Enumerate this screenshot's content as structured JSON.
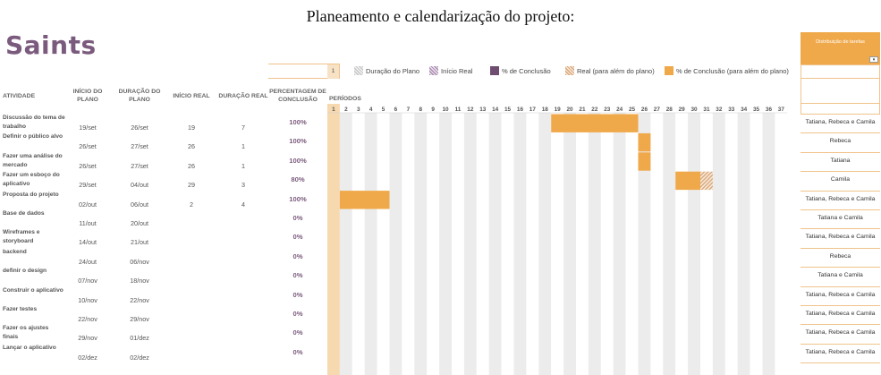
{
  "document_title": "Planeamento e calendarização do projeto:",
  "app_title": "Saints",
  "period_highlight": "1",
  "legend": [
    {
      "label": "Duração do Plano",
      "swatch": "plan-hatch"
    },
    {
      "label": "Início Real",
      "swatch": "start-hatch"
    },
    {
      "label": "% de Conclusão",
      "swatch": "purple-solid",
      "color": "#6f4d70"
    },
    {
      "label": "Real (para além do plano)",
      "swatch": "orange-hatch"
    },
    {
      "label": "% de Conclusão (para além do plano)",
      "swatch": "orange-solid",
      "color": "#f0a94a"
    }
  ],
  "headers": {
    "activity": "ATIVIDADE",
    "plan_start": "INÍCIO DO PLANO",
    "plan_duration": "DURAÇÃO DO PLANO",
    "actual_start": "INÍCIO REAL",
    "actual_duration": "DURAÇÃO REAL",
    "percent": "PERCENTAGEM DE CONCLUSÃO",
    "periods": "PERÍODOS"
  },
  "periods": [
    "1",
    "2",
    "3",
    "4",
    "5",
    "6",
    "7",
    "8",
    "9",
    "10",
    "11",
    "12",
    "13",
    "14",
    "15",
    "16",
    "17",
    "18",
    "19",
    "20",
    "21",
    "22",
    "23",
    "24",
    "25",
    "26",
    "27",
    "28",
    "29",
    "30",
    "31",
    "32",
    "33",
    "34",
    "35",
    "36",
    "37"
  ],
  "side_title": "Distribuição de tarefas",
  "side_button": "▾",
  "colors": {
    "accent": "#f0a94a",
    "brand": "#7b5b7d",
    "grid_stripe": "#ececec"
  },
  "rows": [
    {
      "activity": "Discussão do tema de trabalho",
      "plan_start": "19/set",
      "plan_duration": "26/set",
      "actual_start": "19",
      "actual_duration": "7",
      "percent": "100%",
      "assignee": "Tatiana, Rebeca e Camila",
      "bar_start": 19,
      "bar_length": 7,
      "hatch_start": 0,
      "hatch_length": 0
    },
    {
      "activity": "Definir o público alvo",
      "plan_start": "26/set",
      "plan_duration": "27/set",
      "actual_start": "26",
      "actual_duration": "1",
      "percent": "100%",
      "assignee": "Rebeca",
      "bar_start": 26,
      "bar_length": 1,
      "hatch_start": 0,
      "hatch_length": 0
    },
    {
      "activity": "Fazer uma análise do mercado",
      "plan_start": "26/set",
      "plan_duration": "27/set",
      "actual_start": "26",
      "actual_duration": "1",
      "percent": "100%",
      "assignee": "Tatiana",
      "bar_start": 26,
      "bar_length": 1,
      "hatch_start": 0,
      "hatch_length": 0
    },
    {
      "activity": "Fazer um esboço do aplicativo",
      "plan_start": "29/set",
      "plan_duration": "04/out",
      "actual_start": "29",
      "actual_duration": "3",
      "percent": "80%",
      "assignee": "Camila",
      "bar_start": 29,
      "bar_length": 2,
      "hatch_start": 31,
      "hatch_length": 1
    },
    {
      "activity": "Proposta do projeto",
      "plan_start": "02/out",
      "plan_duration": "06/out",
      "actual_start": "2",
      "actual_duration": "4",
      "percent": "100%",
      "assignee": "Tatiana, Rebeca e Camila",
      "bar_start": 2,
      "bar_length": 4,
      "hatch_start": 0,
      "hatch_length": 0
    },
    {
      "activity": "Base de dados",
      "plan_start": "11/out",
      "plan_duration": "20/out",
      "actual_start": "",
      "actual_duration": "",
      "percent": "0%",
      "assignee": "Tatiana e Camila",
      "bar_start": 0,
      "bar_length": 0,
      "hatch_start": 0,
      "hatch_length": 0
    },
    {
      "activity": "Wireframes e storyboard",
      "plan_start": "14/out",
      "plan_duration": "21/out",
      "actual_start": "",
      "actual_duration": "",
      "percent": "0%",
      "assignee": "Tatiana, Rebeca e Camila",
      "bar_start": 0,
      "bar_length": 0,
      "hatch_start": 0,
      "hatch_length": 0
    },
    {
      "activity": "backend",
      "plan_start": "24/out",
      "plan_duration": "06/nov",
      "actual_start": "",
      "actual_duration": "",
      "percent": "0%",
      "assignee": "Rebeca",
      "bar_start": 0,
      "bar_length": 0,
      "hatch_start": 0,
      "hatch_length": 0
    },
    {
      "activity": "definir o design",
      "plan_start": "07/nov",
      "plan_duration": "18/nov",
      "actual_start": "",
      "actual_duration": "",
      "percent": "0%",
      "assignee": "Tatiana e Camila",
      "bar_start": 0,
      "bar_length": 0,
      "hatch_start": 0,
      "hatch_length": 0
    },
    {
      "activity": "Construir o aplicativo",
      "plan_start": "10/nov",
      "plan_duration": "22/nov",
      "actual_start": "",
      "actual_duration": "",
      "percent": "0%",
      "assignee": "Tatiana, Rebeca e Camila",
      "bar_start": 0,
      "bar_length": 0,
      "hatch_start": 0,
      "hatch_length": 0
    },
    {
      "activity": "Fazer testes",
      "plan_start": "22/nov",
      "plan_duration": "29/nov",
      "actual_start": "",
      "actual_duration": "",
      "percent": "0%",
      "assignee": "Tatiana, Rebeca e Camila",
      "bar_start": 0,
      "bar_length": 0,
      "hatch_start": 0,
      "hatch_length": 0
    },
    {
      "activity": "Fazer os ajustes finais",
      "plan_start": "29/nov",
      "plan_duration": "01/dez",
      "actual_start": "",
      "actual_duration": "",
      "percent": "0%",
      "assignee": "Tatiana, Rebeca e Camila",
      "bar_start": 0,
      "bar_length": 0,
      "hatch_start": 0,
      "hatch_length": 0
    },
    {
      "activity": "Lançar o aplicativo",
      "plan_start": "02/dez",
      "plan_duration": "02/dez",
      "actual_start": "",
      "actual_duration": "",
      "percent": "0%",
      "assignee": "Tatiana, Rebeca e Camila",
      "bar_start": 0,
      "bar_length": 0,
      "hatch_start": 0,
      "hatch_length": 0
    }
  ]
}
